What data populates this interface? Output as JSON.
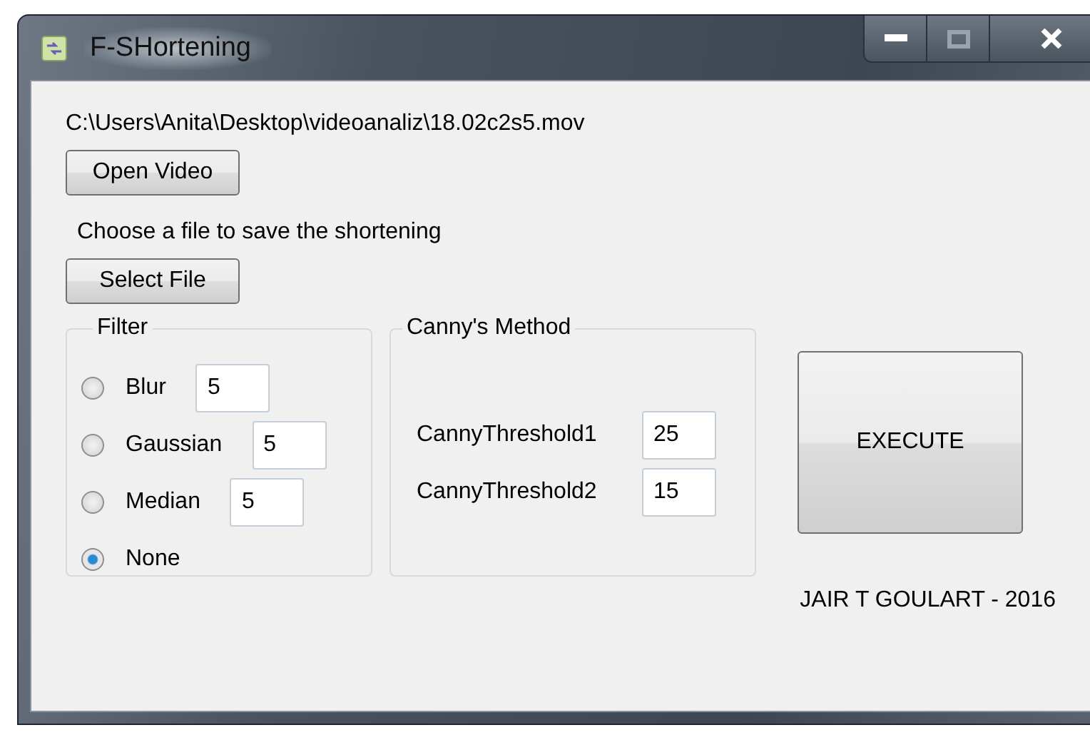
{
  "window": {
    "title": "F-SHortening"
  },
  "video_path": "C:\\Users\\Anita\\Desktop\\videoanaliz\\18.02c2s5.mov",
  "open_button": "Open Video",
  "save_prompt": "Choose a file to save the shortening",
  "select_button": "Select File",
  "filter": {
    "title": "Filter",
    "options": [
      {
        "label": "Blur",
        "selected": false,
        "value": "5"
      },
      {
        "label": "Gaussian",
        "selected": false,
        "value": "5"
      },
      {
        "label": "Median",
        "selected": false,
        "value": "5"
      },
      {
        "label": "None",
        "selected": true
      }
    ]
  },
  "canny": {
    "title": "Canny's Method",
    "fields": [
      {
        "label": "CannyThreshold1",
        "value": "25"
      },
      {
        "label": "CannyThreshold2",
        "value": "15"
      }
    ]
  },
  "execute_button": "EXECUTE",
  "credit": "JAIR T GOULART - 2016"
}
